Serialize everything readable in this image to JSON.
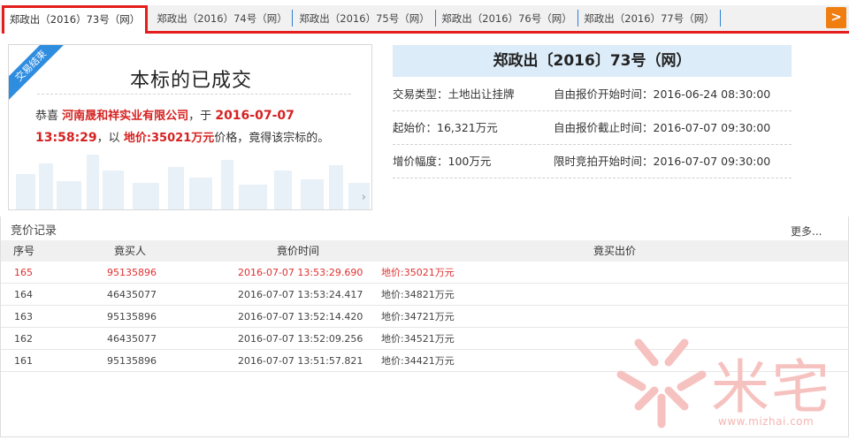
{
  "tabs": [
    {
      "label": "郑政出（2016）73号（网）",
      "active": true
    },
    {
      "label": "郑政出（2016）74号（网）",
      "active": false
    },
    {
      "label": "郑政出（2016）75号（网）",
      "active": false
    },
    {
      "label": "郑政出（2016）76号（网）",
      "active": false
    },
    {
      "label": "郑政出（2016）77号（网）",
      "active": false
    }
  ],
  "tab_next_label": ">",
  "result": {
    "ribbon": "交易结束",
    "title": "本标的已成交",
    "congrats": "恭喜",
    "company": "河南晟和祥实业有限公司",
    "comma_at": "，于",
    "datetime_date": "2016-07-07",
    "datetime_time": "13:58:29",
    "comma_with": "，以",
    "price": "地价:35021万元",
    "tail": "价格，竟得该宗标的。",
    "arrow": "›"
  },
  "info": {
    "title": "郑政出〔2016〕73号（网）",
    "rows": [
      {
        "c1": "交易类型：土地出让挂牌",
        "c2": "自由报价开始时间：2016-06-24 08:30:00"
      },
      {
        "c1": "起始价：16,321万元",
        "c2": "自由报价截止时间：2016-07-07 09:30:00"
      },
      {
        "c1": "增价幅度：100万元",
        "c2": "限时竞拍开始时间：2016-07-07 09:30:00"
      }
    ]
  },
  "records": {
    "title": "竞价记录",
    "more": "更多...",
    "headers": [
      "序号",
      "竟买人",
      "竟价时间",
      "竟买出价"
    ],
    "rows": [
      {
        "no": "165",
        "bidder": "95135896",
        "time": "2016-07-07 13:53:29.690",
        "price": "地价:35021万元",
        "hot": true
      },
      {
        "no": "164",
        "bidder": "46435077",
        "time": "2016-07-07 13:53:24.417",
        "price": "地价:34821万元",
        "hot": false
      },
      {
        "no": "163",
        "bidder": "95135896",
        "time": "2016-07-07 13:52:14.420",
        "price": "地价:34721万元",
        "hot": false
      },
      {
        "no": "162",
        "bidder": "46435077",
        "time": "2016-07-07 13:52:09.256",
        "price": "地价:34521万元",
        "hot": false
      },
      {
        "no": "161",
        "bidder": "95135896",
        "time": "2016-07-07 13:51:57.821",
        "price": "地价:34421万元",
        "hot": false
      }
    ]
  },
  "watermark": {
    "brand": "米宅",
    "url": "www.mizhai.com"
  },
  "colors": {
    "accent_red": "#e41d1d",
    "tab_separator": "#2b7fd4",
    "next_button": "#ef7d10",
    "info_header": "#dcecf8",
    "ribbon": "#2f8de0",
    "hot_text": "#e03030"
  }
}
